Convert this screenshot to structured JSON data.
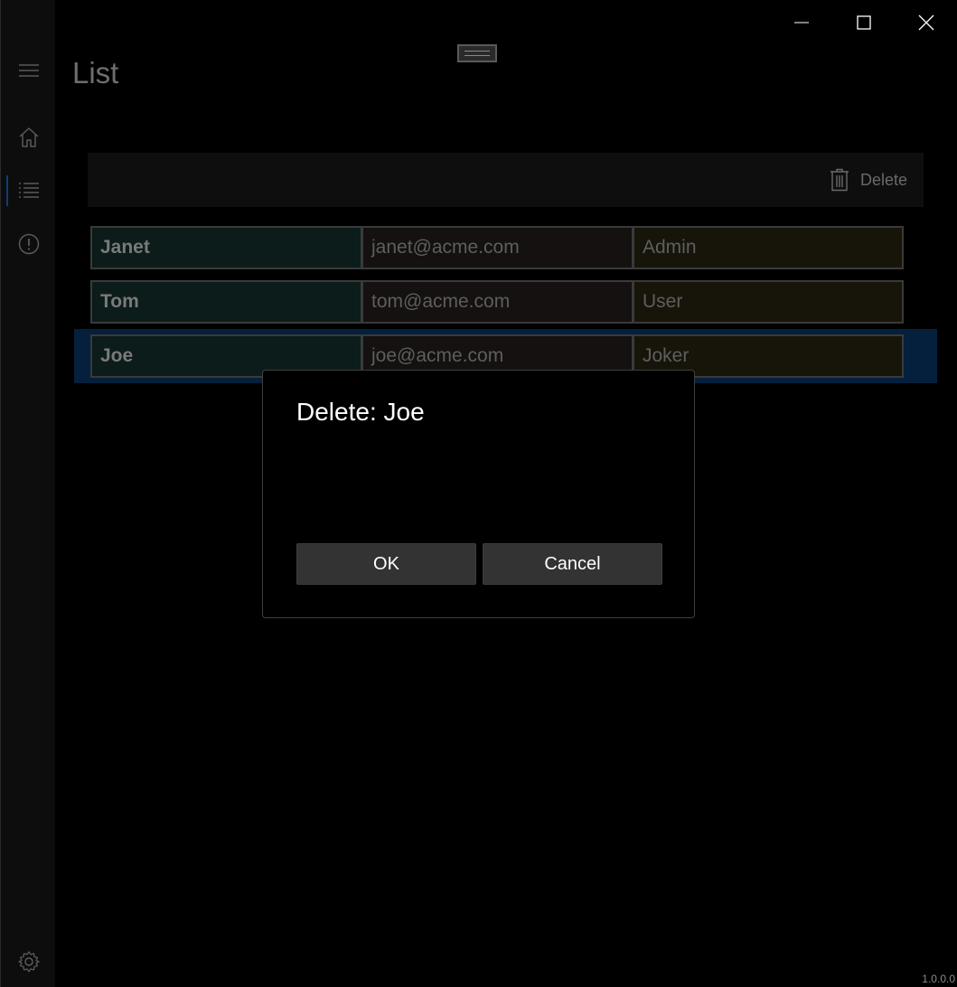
{
  "window": {
    "title": "List",
    "version": "1.0.0.0"
  },
  "title_bar": {
    "minimize_icon": "minimize-icon",
    "maximize_icon": "maximize-icon",
    "close_icon": "close-icon"
  },
  "nav": {
    "items": [
      {
        "icon": "hamburger-icon"
      },
      {
        "icon": "home-icon"
      },
      {
        "icon": "list-icon",
        "selected": true
      },
      {
        "icon": "info-icon"
      }
    ],
    "settings_icon": "gear-icon",
    "accent": "#0e3f72"
  },
  "command_bar": {
    "delete_label": "Delete",
    "delete_icon": "trash-icon"
  },
  "users": [
    {
      "name": "Janet",
      "email": "janet@acme.com",
      "role": "Admin"
    },
    {
      "name": "Tom",
      "email": "tom@acme.com",
      "role": "User"
    },
    {
      "name": "Joe",
      "email": "joe@acme.com",
      "role": "Joker",
      "selected": true
    }
  ],
  "dialog": {
    "title": "Delete: Joe",
    "ok_label": "OK",
    "cancel_label": "Cancel"
  }
}
